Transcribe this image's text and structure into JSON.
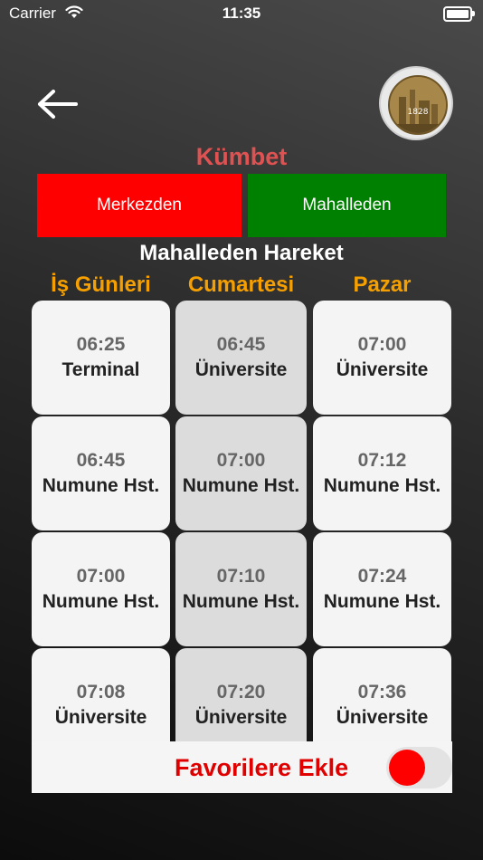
{
  "status": {
    "carrier": "Carrier",
    "time": "11:35"
  },
  "header": {
    "title": "Kümbet",
    "logo_year": "1828"
  },
  "directions": {
    "from_center": "Merkezden",
    "from_district": "Mahalleden"
  },
  "schedule": {
    "subtitle": "Mahalleden Hareket",
    "columns": [
      "İş Günleri",
      "Cumartesi",
      "Pazar"
    ],
    "rows": [
      [
        {
          "time": "06:25",
          "stop": "Terminal"
        },
        {
          "time": "06:45",
          "stop": "Üniversite"
        },
        {
          "time": "07:00",
          "stop": "Üniversite"
        }
      ],
      [
        {
          "time": "06:45",
          "stop": "Numune Hst."
        },
        {
          "time": "07:00",
          "stop": "Numune Hst."
        },
        {
          "time": "07:12",
          "stop": "Numune Hst."
        }
      ],
      [
        {
          "time": "07:00",
          "stop": "Numune Hst."
        },
        {
          "time": "07:10",
          "stop": "Numune Hst."
        },
        {
          "time": "07:24",
          "stop": "Numune Hst."
        }
      ],
      [
        {
          "time": "07:08",
          "stop": "Üniversite"
        },
        {
          "time": "07:20",
          "stop": "Üniversite"
        },
        {
          "time": "07:36",
          "stop": "Üniversite"
        }
      ]
    ]
  },
  "favorite": {
    "label": "Favorilere Ekle",
    "enabled": false
  },
  "colors": {
    "title": "#e05252",
    "from_center": "#ff0000",
    "from_district": "#008000",
    "column_header": "#f5a000",
    "favorite": "#e00000"
  }
}
